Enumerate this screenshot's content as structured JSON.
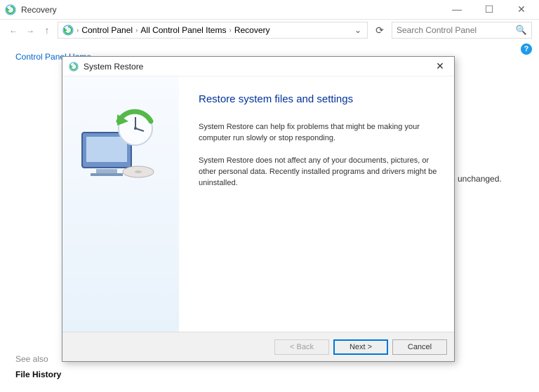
{
  "window": {
    "title": "Recovery"
  },
  "breadcrumb": {
    "items": [
      "Control Panel",
      "All Control Panel Items",
      "Recovery"
    ]
  },
  "search": {
    "placeholder": "Search Control Panel"
  },
  "sidebar": {
    "home_link": "Control Panel Home"
  },
  "background": {
    "truncated_text": "ic unchanged."
  },
  "see_also": {
    "label": "See also",
    "link": "File History"
  },
  "dialog": {
    "title": "System Restore",
    "heading": "Restore system files and settings",
    "para1": "System Restore can help fix problems that might be making your computer run slowly or stop responding.",
    "para2": "System Restore does not affect any of your documents, pictures, or other personal data. Recently installed programs and drivers might be uninstalled.",
    "buttons": {
      "back": "< Back",
      "next": "Next >",
      "cancel": "Cancel"
    }
  }
}
